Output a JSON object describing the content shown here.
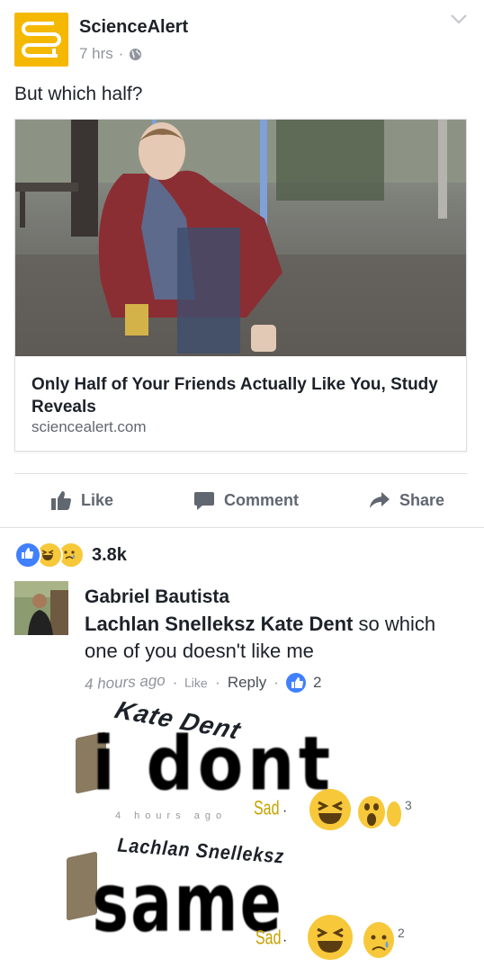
{
  "post": {
    "page_name": "ScienceAlert",
    "time": "7 hrs",
    "separator": "·",
    "caption": "But which half?",
    "link": {
      "title": "Only Half of Your Friends Actually Like You, Study Reveals",
      "domain": "sciencealert.com"
    }
  },
  "actions": {
    "like": "Like",
    "comment": "Comment",
    "share": "Share"
  },
  "reactions": {
    "count": "3.8k",
    "types": [
      "like-icon",
      "haha-icon",
      "sad-icon"
    ]
  },
  "comment": {
    "author": "Gabriel Bautista",
    "mention1": "Lachlan Snelleksz",
    "mention2": "Kate Dent",
    "text": "so which one of you doesn't like me",
    "time": "4 hours ago",
    "like_label": "Like",
    "reply_label": "Reply",
    "likes": "2"
  },
  "meme1": {
    "name": "Kate Dent",
    "text": "i dont",
    "time": "4 hours ago",
    "reaction": "Sad",
    "count": "3"
  },
  "meme2": {
    "name": "Lachlan Snelleksz",
    "text": "same",
    "reaction": "Sad",
    "count": "2"
  },
  "colors": {
    "brand": "#f5b800",
    "fb_blue": "#4080ff",
    "text": "#1d2129",
    "muted": "#90949c"
  }
}
